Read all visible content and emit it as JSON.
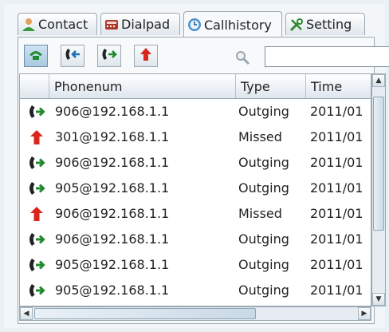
{
  "tabs": [
    {
      "label": "Contact",
      "icon": "contact-icon"
    },
    {
      "label": "Dialpad",
      "icon": "dialpad-icon"
    },
    {
      "label": "Callhistory",
      "icon": "callhistory-icon",
      "active": true
    },
    {
      "label": "Setting",
      "icon": "setting-icon"
    }
  ],
  "toolbar": {
    "buttons": [
      "all-calls-icon",
      "incoming-calls-icon",
      "outgoing-calls-icon",
      "missed-calls-icon"
    ],
    "search_value": ""
  },
  "table": {
    "columns": [
      "Phonenum",
      "Type",
      "Time"
    ],
    "rows": [
      {
        "icon": "outgoing",
        "phonenum": "906@192.168.1.1",
        "type": "Outging",
        "time": "2011/01"
      },
      {
        "icon": "missed",
        "phonenum": "301@192.168.1.1",
        "type": "Missed",
        "time": "2011/01"
      },
      {
        "icon": "outgoing",
        "phonenum": "906@192.168.1.1",
        "type": "Outging",
        "time": "2011/01"
      },
      {
        "icon": "outgoing",
        "phonenum": "905@192.168.1.1",
        "type": "Outging",
        "time": "2011/01"
      },
      {
        "icon": "missed",
        "phonenum": "906@192.168.1.1",
        "type": "Missed",
        "time": "2011/01"
      },
      {
        "icon": "outgoing",
        "phonenum": "906@192.168.1.1",
        "type": "Outging",
        "time": "2011/01"
      },
      {
        "icon": "outgoing",
        "phonenum": "905@192.168.1.1",
        "type": "Outging",
        "time": "2011/01"
      },
      {
        "icon": "outgoing",
        "phonenum": "905@192.168.1.1",
        "type": "Outging",
        "time": "2011/01"
      }
    ]
  },
  "colors": {
    "outgoing": "#1f8a2c",
    "missed": "#d8261d",
    "accent": "#5f93c2"
  }
}
